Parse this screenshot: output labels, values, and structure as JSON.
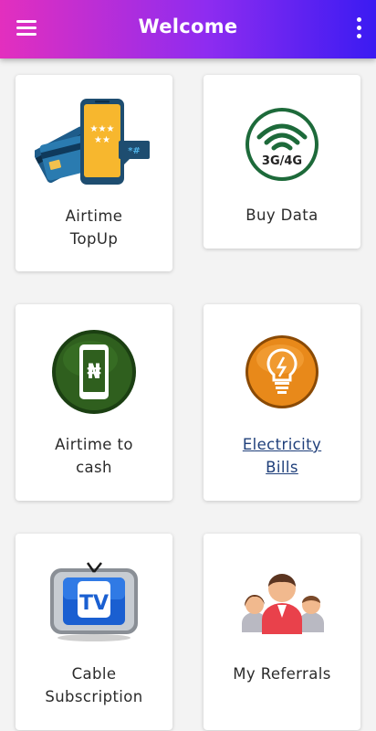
{
  "appbar": {
    "title": "Welcome",
    "menu_icon": "hamburger-menu-icon",
    "more_icon": "more-vertical-icon",
    "gradient": [
      "#e32fbe",
      "#8e2cf0",
      "#3b1bf2"
    ]
  },
  "cards": [
    {
      "id": "airtime-topup",
      "label": "Airtime\nTopUp",
      "icon": "phone-card-icon"
    },
    {
      "id": "buy-data",
      "label": "Buy Data",
      "icon": "3g-4g-wifi-icon",
      "icon_text": "3G/4G"
    },
    {
      "id": "airtime-to-cash",
      "label": "Airtime to\ncash",
      "icon": "naira-phone-icon",
      "icon_text": "₦"
    },
    {
      "id": "electricity-bills",
      "label": "Electricity\nBills",
      "icon": "lightbulb-icon"
    },
    {
      "id": "cable-subscription",
      "label": "Cable\nSubscription",
      "icon": "tv-icon",
      "icon_text": "TV"
    },
    {
      "id": "my-referrals",
      "label": "My Referrals",
      "icon": "people-group-icon"
    }
  ]
}
